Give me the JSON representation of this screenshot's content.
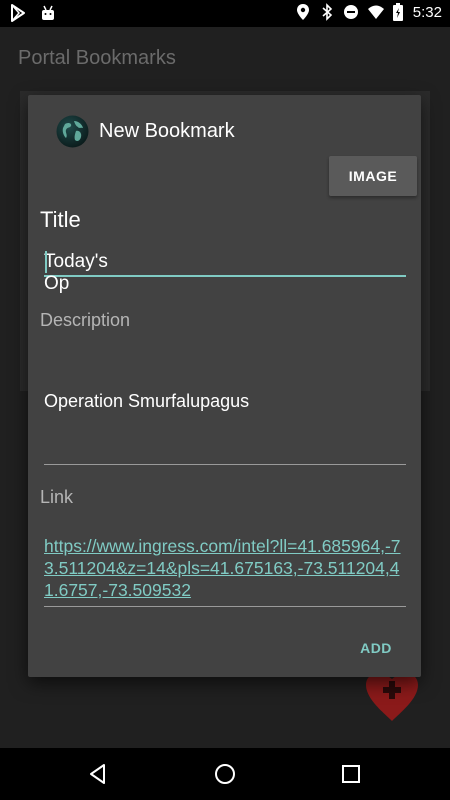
{
  "status_bar": {
    "time": "5:32",
    "left_icons": [
      "play-store-icon",
      "android-icon"
    ],
    "right_icons": [
      "location-icon",
      "bluetooth-icon",
      "dnd-icon",
      "wifi-icon",
      "battery-icon"
    ]
  },
  "app": {
    "title": "Portal Bookmarks"
  },
  "dialog": {
    "title": "New Bookmark",
    "image_button": "IMAGE",
    "title_label": "Title",
    "title_value": "Today's Op",
    "description_label": "Description",
    "description_value": "Operation Smurfalupagus",
    "link_label": "Link",
    "link_value": "https://www.ingress.com/intel?ll=41.685964,-73.511204&z=14&pls=41.675163,-73.511204,41.6757,-73.509532",
    "add_button": "ADD"
  },
  "colors": {
    "accent": "#80cbc4",
    "dialog_bg": "#424242",
    "app_bg": "#202020",
    "fab_red": "#b71c1c"
  },
  "nav_bar": {
    "buttons": [
      "back-icon",
      "home-icon",
      "recents-icon"
    ]
  }
}
